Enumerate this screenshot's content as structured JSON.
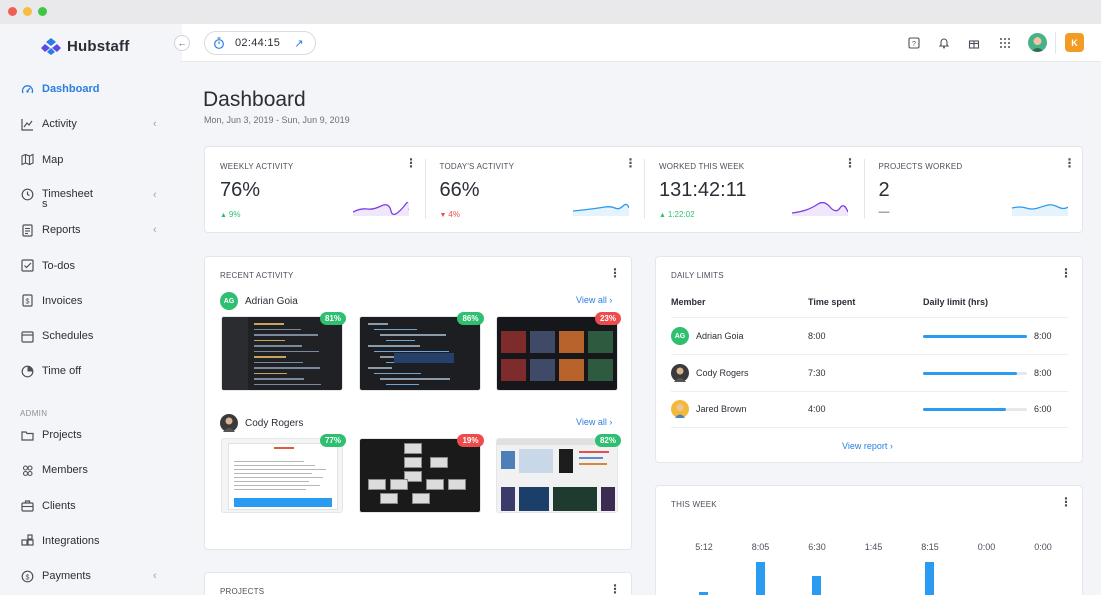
{
  "window": {
    "dots": [
      "#ee5f58",
      "#f7bd3c",
      "#3ec744"
    ]
  },
  "brand": {
    "name": "Hubstaff",
    "logo_icon": "hubstaff-logo-icon"
  },
  "sidebar": {
    "items": [
      {
        "label": "Dashboard",
        "icon": "dashboard-icon",
        "active": true
      },
      {
        "label": "Activity",
        "icon": "activity-icon",
        "chevron": true
      },
      {
        "label": "Map",
        "icon": "map-icon"
      },
      {
        "label": "Timesheet\ns",
        "icon": "clock-icon",
        "chevron": true
      },
      {
        "label": "Reports",
        "icon": "reports-icon",
        "chevron": true
      },
      {
        "label": "To-dos",
        "icon": "todos-icon"
      },
      {
        "label": "Invoices",
        "icon": "invoices-icon"
      },
      {
        "label": "Schedules",
        "icon": "calendar-icon"
      },
      {
        "label": "Time off",
        "icon": "timeoff-icon"
      }
    ],
    "admin_label": "ADMIN",
    "admin_items": [
      {
        "label": "Projects",
        "icon": "folder-icon"
      },
      {
        "label": "Members",
        "icon": "members-icon"
      },
      {
        "label": "Clients",
        "icon": "clients-icon"
      },
      {
        "label": "Integrations",
        "icon": "integrations-icon"
      },
      {
        "label": "Payments",
        "icon": "payments-icon",
        "chevron": true
      }
    ]
  },
  "topbar": {
    "timer": "02:44:15",
    "icons": [
      "help-icon",
      "bell-icon",
      "gift-icon",
      "apps-grid-icon"
    ],
    "org_badge": "K"
  },
  "page": {
    "title": "Dashboard",
    "dates": "Mon, Jun 3, 2019 - Sun, Jun 9, 2019"
  },
  "stats": [
    {
      "title": "WEEKLY ACTIVITY",
      "value": "76%",
      "delta": "9%",
      "direction": "up",
      "color": "#7b3fe4"
    },
    {
      "title": "TODAY'S ACTIVITY",
      "value": "66%",
      "delta": "4%",
      "direction": "down",
      "color": "#2a9bf0"
    },
    {
      "title": "WORKED THIS WEEK",
      "value": "131:42:11",
      "delta": "1:22:02",
      "direction": "up",
      "color": "#7b3fe4"
    },
    {
      "title": "PROJECTS WORKED",
      "value": "2",
      "delta": "—",
      "direction": "none",
      "color": "#2a9bf0"
    }
  ],
  "recent_activity": {
    "title": "RECENT ACTIVITY",
    "view_all": "View all",
    "members": [
      {
        "name": "Adrian Goia",
        "initials": "AG",
        "shots": [
          {
            "pct": "81%",
            "badge": "#2fbf71"
          },
          {
            "pct": "86%",
            "badge": "#2fbf71"
          },
          {
            "pct": "23%",
            "badge": "#ee4c4c"
          }
        ]
      },
      {
        "name": "Cody Rogers",
        "initials": "",
        "shots": [
          {
            "pct": "77%",
            "badge": "#2fbf71"
          },
          {
            "pct": "19%",
            "badge": "#ee4c4c"
          },
          {
            "pct": "82%",
            "badge": "#2fbf71"
          }
        ]
      }
    ]
  },
  "daily_limits": {
    "title": "DAILY LIMITS",
    "headers": [
      "Member",
      "Time spent",
      "Daily limit (hrs)"
    ],
    "rows": [
      {
        "name": "Adrian Goia",
        "initials": "AG",
        "spent": "8:00",
        "limit": "8:00",
        "fill": 1.0
      },
      {
        "name": "Cody Rogers",
        "initials": "",
        "spent": "7:30",
        "limit": "8:00",
        "fill": 0.9
      },
      {
        "name": "Jared Brown",
        "initials": "",
        "spent": "4:00",
        "limit": "6:00",
        "fill": 0.8
      }
    ],
    "view_report": "View report"
  },
  "this_week": {
    "title": "THIS WEEK",
    "labels": [
      "5:12",
      "8:05",
      "6:30",
      "1:45",
      "8:15",
      "0:00",
      "0:00"
    ]
  },
  "projects": {
    "title": "PROJECTS"
  }
}
